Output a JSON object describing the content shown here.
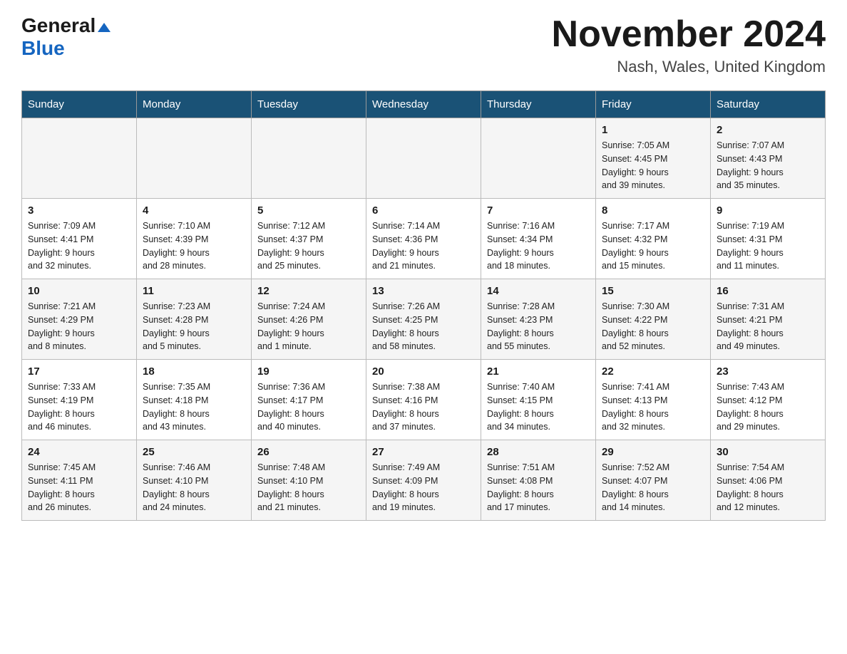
{
  "header": {
    "logo_general": "General",
    "logo_blue": "Blue",
    "month_title": "November 2024",
    "location": "Nash, Wales, United Kingdom"
  },
  "days_of_week": [
    "Sunday",
    "Monday",
    "Tuesday",
    "Wednesday",
    "Thursday",
    "Friday",
    "Saturday"
  ],
  "weeks": [
    [
      {
        "day": "",
        "info": ""
      },
      {
        "day": "",
        "info": ""
      },
      {
        "day": "",
        "info": ""
      },
      {
        "day": "",
        "info": ""
      },
      {
        "day": "",
        "info": ""
      },
      {
        "day": "1",
        "info": "Sunrise: 7:05 AM\nSunset: 4:45 PM\nDaylight: 9 hours\nand 39 minutes."
      },
      {
        "day": "2",
        "info": "Sunrise: 7:07 AM\nSunset: 4:43 PM\nDaylight: 9 hours\nand 35 minutes."
      }
    ],
    [
      {
        "day": "3",
        "info": "Sunrise: 7:09 AM\nSunset: 4:41 PM\nDaylight: 9 hours\nand 32 minutes."
      },
      {
        "day": "4",
        "info": "Sunrise: 7:10 AM\nSunset: 4:39 PM\nDaylight: 9 hours\nand 28 minutes."
      },
      {
        "day": "5",
        "info": "Sunrise: 7:12 AM\nSunset: 4:37 PM\nDaylight: 9 hours\nand 25 minutes."
      },
      {
        "day": "6",
        "info": "Sunrise: 7:14 AM\nSunset: 4:36 PM\nDaylight: 9 hours\nand 21 minutes."
      },
      {
        "day": "7",
        "info": "Sunrise: 7:16 AM\nSunset: 4:34 PM\nDaylight: 9 hours\nand 18 minutes."
      },
      {
        "day": "8",
        "info": "Sunrise: 7:17 AM\nSunset: 4:32 PM\nDaylight: 9 hours\nand 15 minutes."
      },
      {
        "day": "9",
        "info": "Sunrise: 7:19 AM\nSunset: 4:31 PM\nDaylight: 9 hours\nand 11 minutes."
      }
    ],
    [
      {
        "day": "10",
        "info": "Sunrise: 7:21 AM\nSunset: 4:29 PM\nDaylight: 9 hours\nand 8 minutes."
      },
      {
        "day": "11",
        "info": "Sunrise: 7:23 AM\nSunset: 4:28 PM\nDaylight: 9 hours\nand 5 minutes."
      },
      {
        "day": "12",
        "info": "Sunrise: 7:24 AM\nSunset: 4:26 PM\nDaylight: 9 hours\nand 1 minute."
      },
      {
        "day": "13",
        "info": "Sunrise: 7:26 AM\nSunset: 4:25 PM\nDaylight: 8 hours\nand 58 minutes."
      },
      {
        "day": "14",
        "info": "Sunrise: 7:28 AM\nSunset: 4:23 PM\nDaylight: 8 hours\nand 55 minutes."
      },
      {
        "day": "15",
        "info": "Sunrise: 7:30 AM\nSunset: 4:22 PM\nDaylight: 8 hours\nand 52 minutes."
      },
      {
        "day": "16",
        "info": "Sunrise: 7:31 AM\nSunset: 4:21 PM\nDaylight: 8 hours\nand 49 minutes."
      }
    ],
    [
      {
        "day": "17",
        "info": "Sunrise: 7:33 AM\nSunset: 4:19 PM\nDaylight: 8 hours\nand 46 minutes."
      },
      {
        "day": "18",
        "info": "Sunrise: 7:35 AM\nSunset: 4:18 PM\nDaylight: 8 hours\nand 43 minutes."
      },
      {
        "day": "19",
        "info": "Sunrise: 7:36 AM\nSunset: 4:17 PM\nDaylight: 8 hours\nand 40 minutes."
      },
      {
        "day": "20",
        "info": "Sunrise: 7:38 AM\nSunset: 4:16 PM\nDaylight: 8 hours\nand 37 minutes."
      },
      {
        "day": "21",
        "info": "Sunrise: 7:40 AM\nSunset: 4:15 PM\nDaylight: 8 hours\nand 34 minutes."
      },
      {
        "day": "22",
        "info": "Sunrise: 7:41 AM\nSunset: 4:13 PM\nDaylight: 8 hours\nand 32 minutes."
      },
      {
        "day": "23",
        "info": "Sunrise: 7:43 AM\nSunset: 4:12 PM\nDaylight: 8 hours\nand 29 minutes."
      }
    ],
    [
      {
        "day": "24",
        "info": "Sunrise: 7:45 AM\nSunset: 4:11 PM\nDaylight: 8 hours\nand 26 minutes."
      },
      {
        "day": "25",
        "info": "Sunrise: 7:46 AM\nSunset: 4:10 PM\nDaylight: 8 hours\nand 24 minutes."
      },
      {
        "day": "26",
        "info": "Sunrise: 7:48 AM\nSunset: 4:10 PM\nDaylight: 8 hours\nand 21 minutes."
      },
      {
        "day": "27",
        "info": "Sunrise: 7:49 AM\nSunset: 4:09 PM\nDaylight: 8 hours\nand 19 minutes."
      },
      {
        "day": "28",
        "info": "Sunrise: 7:51 AM\nSunset: 4:08 PM\nDaylight: 8 hours\nand 17 minutes."
      },
      {
        "day": "29",
        "info": "Sunrise: 7:52 AM\nSunset: 4:07 PM\nDaylight: 8 hours\nand 14 minutes."
      },
      {
        "day": "30",
        "info": "Sunrise: 7:54 AM\nSunset: 4:06 PM\nDaylight: 8 hours\nand 12 minutes."
      }
    ]
  ]
}
